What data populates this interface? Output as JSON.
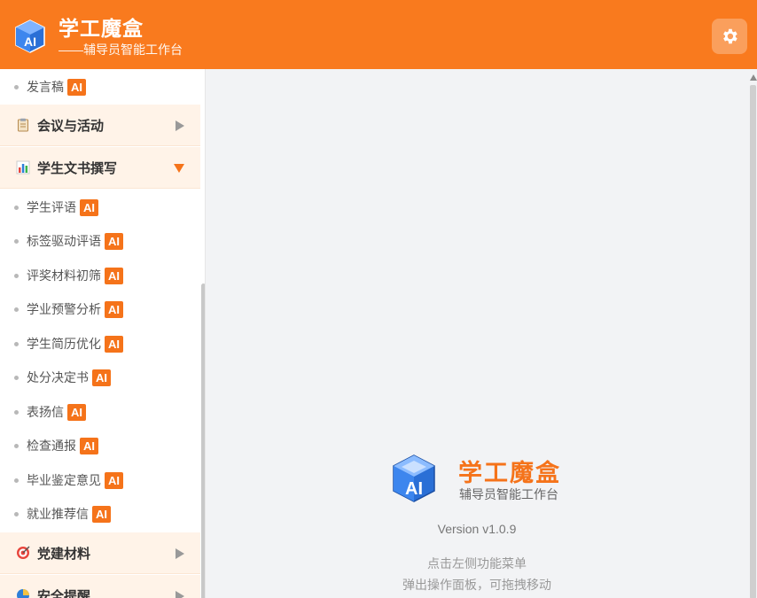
{
  "header": {
    "title": "学工魔盒",
    "subtitle": "——辅导员智能工作台"
  },
  "sidebar": {
    "top_items": [
      {
        "label": "发言稿",
        "badge": "AI"
      }
    ],
    "groups": [
      {
        "label": "会议与活动",
        "expanded": false
      },
      {
        "label": "学生文书撰写",
        "expanded": true
      },
      {
        "label": "党建材料",
        "expanded": false
      },
      {
        "label": "安全提醒",
        "expanded": false
      }
    ],
    "writing_items": [
      {
        "label": "学生评语",
        "badge": "AI"
      },
      {
        "label": "标签驱动评语",
        "badge": "AI"
      },
      {
        "label": "评奖材料初筛",
        "badge": "AI"
      },
      {
        "label": "学业预警分析",
        "badge": "AI"
      },
      {
        "label": "学生简历优化",
        "badge": "AI"
      },
      {
        "label": "处分决定书",
        "badge": "AI"
      },
      {
        "label": "表扬信",
        "badge": "AI"
      },
      {
        "label": "检查通报",
        "badge": "AI"
      },
      {
        "label": "毕业鉴定意见",
        "badge": "AI"
      },
      {
        "label": "就业推荐信",
        "badge": "AI"
      }
    ]
  },
  "welcome": {
    "title": "学工魔盒",
    "subtitle": "辅导员智能工作台",
    "version": "Version v1.0.9",
    "hint_line1": "点击左侧功能菜单",
    "hint_line2": "弹出操作面板，可拖拽移动"
  },
  "colors": {
    "brand": "#f97a1e",
    "badge": "#f5731a",
    "group_bg": "#fff3e8"
  },
  "icons": {
    "logo": "ai-cube-icon",
    "settings": "gear-icon",
    "meeting": "clipboard-icon",
    "writing": "bar-chart-icon",
    "party": "target-icon",
    "safety": "pie-chart-icon"
  }
}
